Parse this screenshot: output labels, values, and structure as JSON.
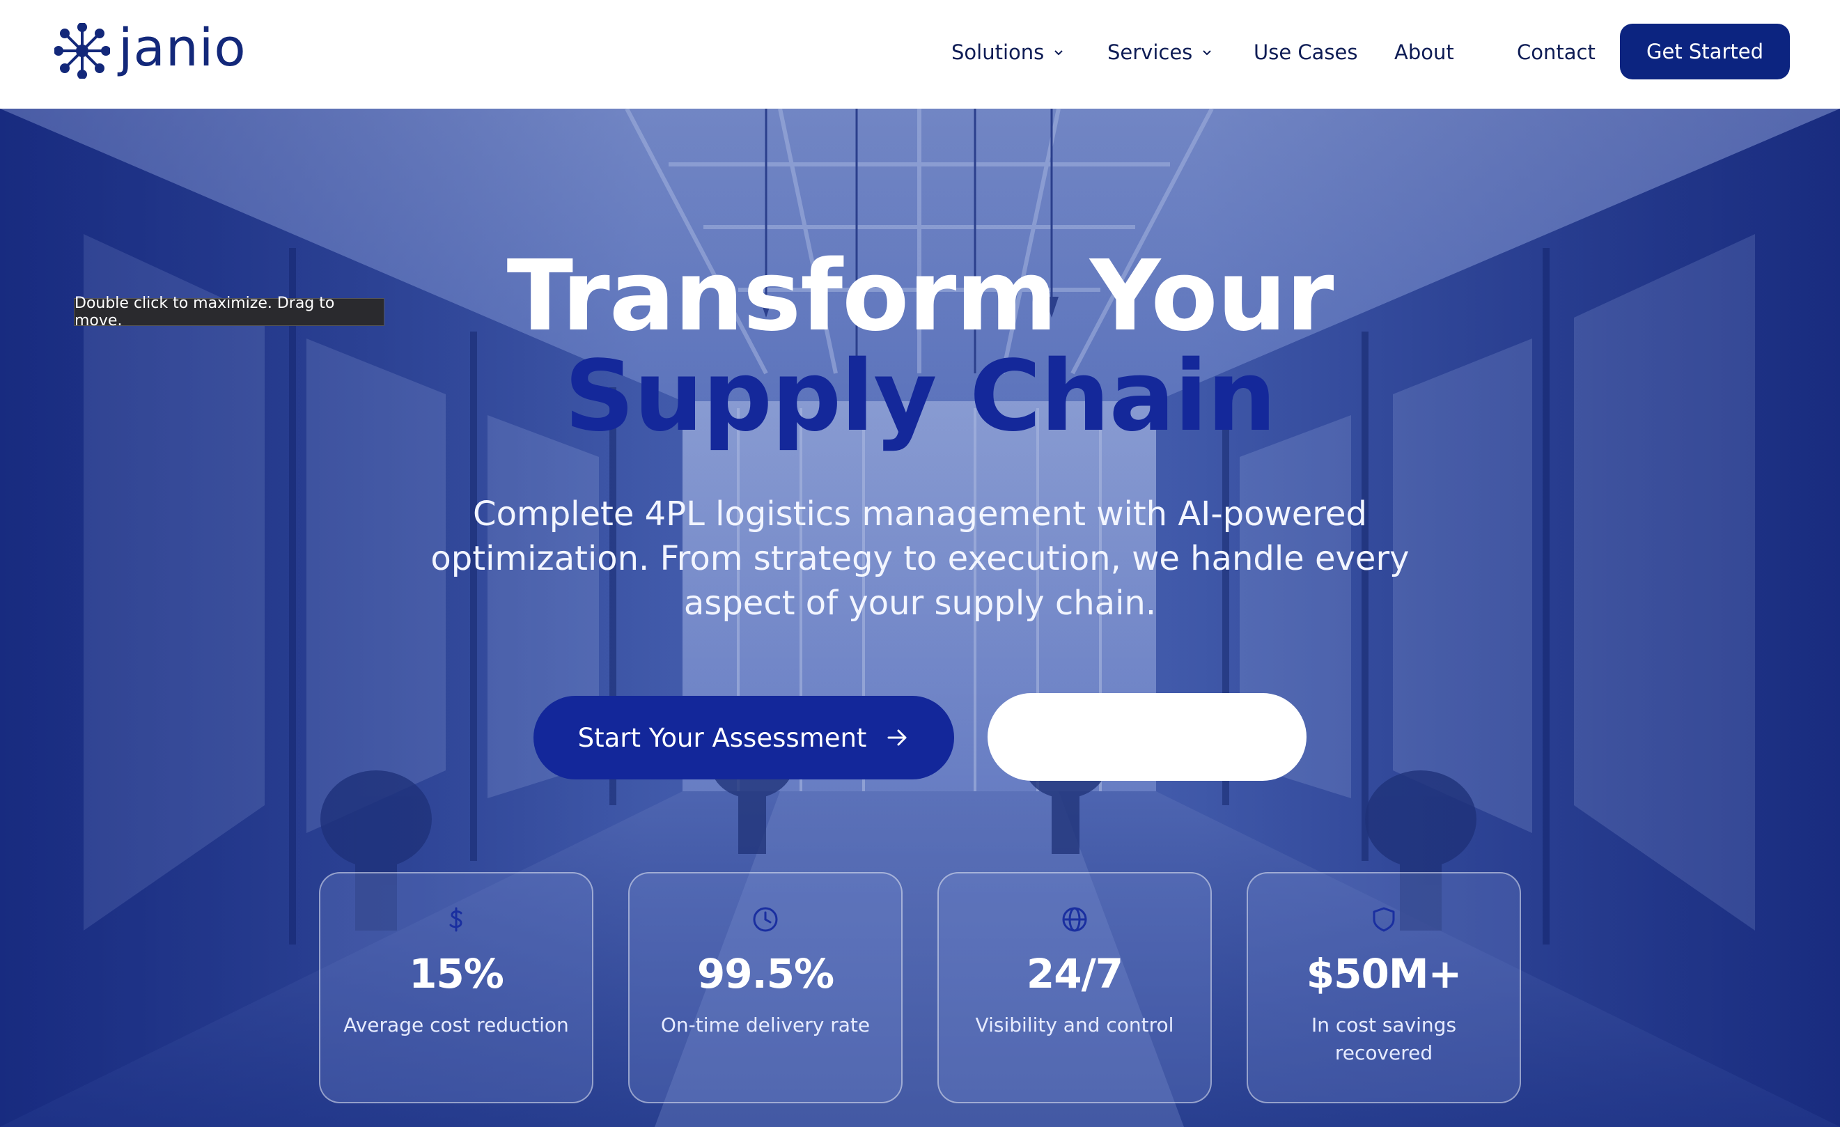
{
  "brand": {
    "name": "janio",
    "color": "#13287a"
  },
  "nav": {
    "items": [
      {
        "label": "Solutions",
        "has_dropdown": true
      },
      {
        "label": "Services",
        "has_dropdown": true
      },
      {
        "label": "Use Cases",
        "has_dropdown": false
      },
      {
        "label": "About",
        "has_dropdown": false
      },
      {
        "label": "Contact",
        "has_dropdown": false
      }
    ],
    "cta_label": "Get Started"
  },
  "tooltip": "Double click to maximize. Drag to move.",
  "hero": {
    "title_line1": "Transform Your",
    "title_line2": "Supply Chain",
    "subtitle": "Complete 4PL logistics management with AI-powered optimization. From strategy to execution, we handle every aspect of your supply chain.",
    "primary_button": "Start Your Assessment",
    "secondary_button": ""
  },
  "stats": [
    {
      "icon": "dollar-icon",
      "value": "15%",
      "label": "Average cost reduction"
    },
    {
      "icon": "clock-icon",
      "value": "99.5%",
      "label": "On-time delivery rate"
    },
    {
      "icon": "globe-icon",
      "value": "24/7",
      "label": "Visibility and control"
    },
    {
      "icon": "shield-icon",
      "value": "$50M+",
      "label": "In cost savings recovered"
    }
  ],
  "colors": {
    "primary": "#13279a",
    "nav_cta": "#0c2480",
    "nav_text": "#0e1c55",
    "title_accent": "#14289a"
  }
}
